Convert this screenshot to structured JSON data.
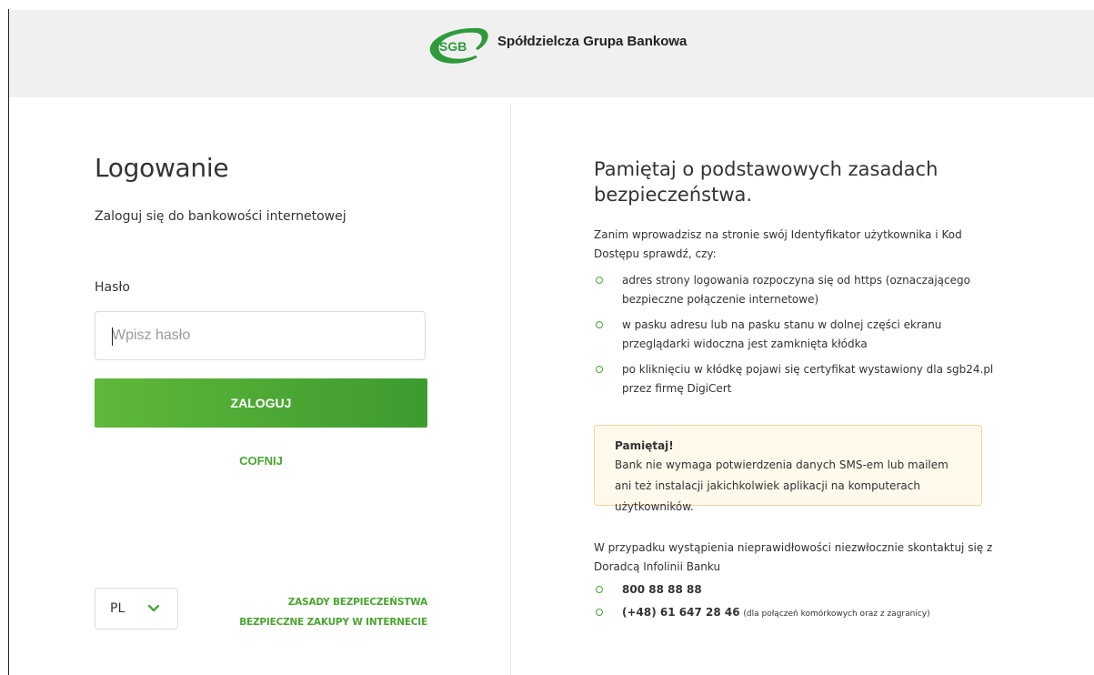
{
  "header": {
    "logo_text": "SGB",
    "brand_name": "Spółdzielcza Grupa Bankowa",
    "colors": {
      "brand_green": "#2e9a3a",
      "accent": "#4aa52f"
    }
  },
  "login": {
    "title": "Logowanie",
    "subtitle": "Zaloguj się do bankowości internetowej",
    "password_label": "Hasło",
    "password_placeholder": "Wpisz hasło",
    "password_value": "",
    "login_button": "ZALOGUJ",
    "back_button": "COFNIJ",
    "language": {
      "selected": "PL",
      "icon": "chevron-down-icon"
    },
    "links": [
      {
        "label": "ZASADY BEZPIECZEŃSTWA"
      },
      {
        "label": "BEZPIECZNE ZAKUPY W INTERNECIE"
      }
    ]
  },
  "security": {
    "title": "Pamiętaj o podstawowych zasadach bezpieczeństwa.",
    "intro": "Zanim wprowadzisz na stronie swój Identyfikator użytkownika i Kod Dostępu sprawdź, czy:",
    "items": [
      "adres strony logowania rozpoczyna się od https (oznaczającego bezpieczne połączenie internetowe)",
      "w pasku adresu lub na pasku stanu w dolnej części ekranu przeglądarki widoczna jest zamknięta kłódka",
      "po kliknięciu w kłódkę pojawi się certyfikat wystawiony dla sgb24.pl przez firmę DigiCert"
    ],
    "notice": {
      "title": "Pamiętaj!",
      "text": "Bank nie wymaga potwierdzenia danych SMS-em lub mailem ani też instalacji jakichkolwiek aplikacji na komputerach użytkowników."
    },
    "contact_text": "W przypadku wystąpienia nieprawidłowości niezwłocznie skontaktuj się z Doradcą Infolinii Banku",
    "phones": [
      {
        "number": "800 88 88 88",
        "note": ""
      },
      {
        "number": "(+48) 61 647 28 46",
        "note": "(dla połączeń komórkowych oraz z zagranicy)"
      }
    ]
  }
}
